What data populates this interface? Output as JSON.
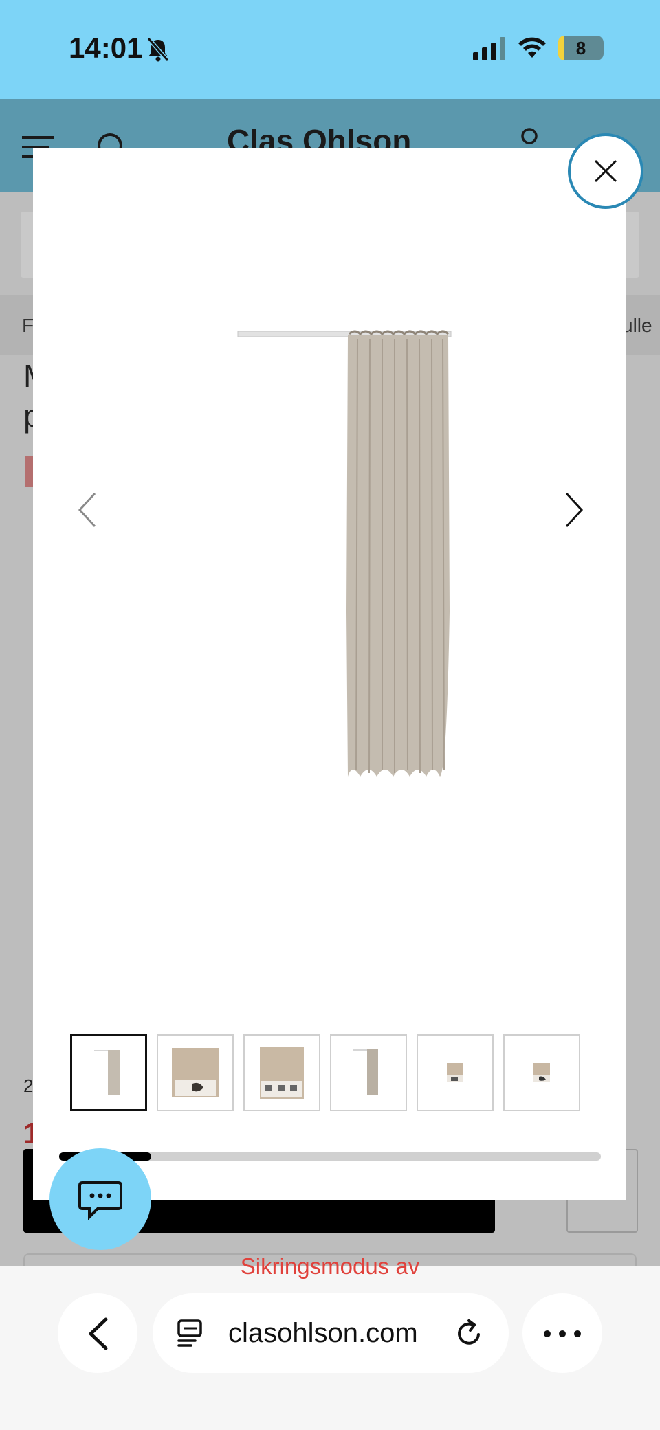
{
  "status_bar": {
    "time": "14:01",
    "battery_level": "8",
    "icons": [
      "bell-slash-icon",
      "cellular-signal-icon",
      "wifi-icon",
      "battery-icon"
    ]
  },
  "background_page": {
    "brand": "Clas Ohlson",
    "breadcrumb_left": "F",
    "breadcrumb_right": "ulle",
    "title_line1": "M",
    "title_line2": "p",
    "old_price_fragment": "2",
    "price_fragment": "1"
  },
  "gallery": {
    "image_count": 6,
    "active_index": 0,
    "scroll_progress": 0.17,
    "thumbnails": [
      {
        "name": "thumb-curtain-front"
      },
      {
        "name": "thumb-package-front"
      },
      {
        "name": "thumb-package-back"
      },
      {
        "name": "thumb-curtain-alt"
      },
      {
        "name": "thumb-package-small"
      },
      {
        "name": "thumb-package-small-2"
      }
    ]
  },
  "browser": {
    "safe_mode_notice": "Sikringsmodus av",
    "url": "clasohlson.com"
  },
  "colors": {
    "status_bar_bg": "#7dd4f7",
    "header_bg_dimmed": "#5b98ad",
    "close_border": "#2a88b4",
    "chat_bg": "#7dd4f7",
    "notice_red": "#e0413b",
    "curtain": "#c4bcb0"
  }
}
